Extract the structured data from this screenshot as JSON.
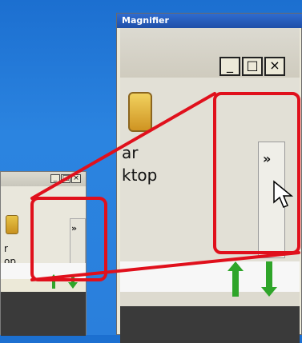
{
  "magnifier": {
    "title": "Magnifier",
    "buttons": {
      "minimize": "_",
      "maximize": "□",
      "close": "×"
    },
    "content": {
      "text_line1": "ar",
      "text_line2": "ktop",
      "chevron": "»"
    }
  },
  "small_window": {
    "buttons": {
      "minimize": "_",
      "maximize": "□",
      "close": "×"
    },
    "content": {
      "text_line1": "r",
      "text_line2": "op",
      "chevron": "»"
    }
  },
  "colors": {
    "desktop": "#2a7fdc",
    "highlight": "#e0101c",
    "arrow_green": "#2fa52a"
  },
  "icons": [
    "program-icon",
    "chevron-right-icon",
    "up-arrow-icon",
    "down-arrow-icon",
    "cursor-icon"
  ]
}
